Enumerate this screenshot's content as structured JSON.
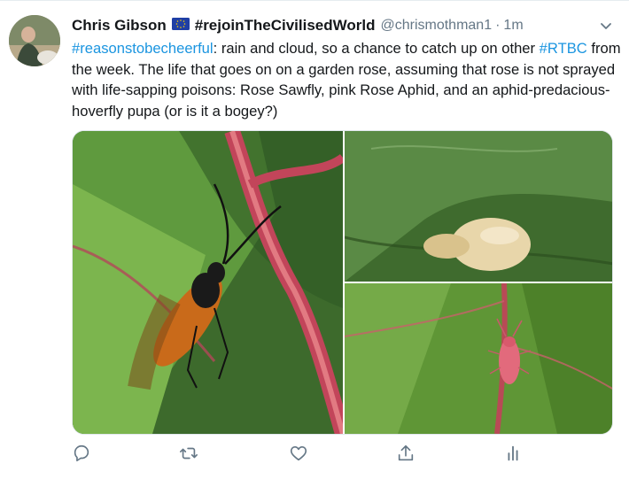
{
  "tweet": {
    "display_name": "Chris Gibson",
    "flag_icon": "eu-flag-icon",
    "hashtag_in_name": "#rejoinTheCivilisedWorld",
    "handle": "@chrismothman1",
    "separator": "·",
    "time": "1m",
    "text_parts": {
      "h1": "#reasonstobecheerful",
      "t1": ": rain and cloud, so a chance to catch up on other ",
      "h2": "#RTBC",
      "t2": " from the week. The life that goes on on a garden rose, assuming that rose is not sprayed with life-sapping poisons: Rose Sawfly, pink Rose Aphid, and an aphid-predacious-hoverfly pupa (or is it a bogey?)"
    },
    "photos": [
      {
        "subject": "rose-sawfly-photo"
      },
      {
        "subject": "hoverfly-pupa-photo"
      },
      {
        "subject": "pink-rose-aphid-photo"
      }
    ],
    "actions": [
      "reply-icon",
      "retweet-icon",
      "like-icon",
      "share-icon",
      "analytics-icon"
    ],
    "colors": {
      "link": "#1b95e0",
      "icon": "#657786",
      "text": "#14171a"
    }
  }
}
